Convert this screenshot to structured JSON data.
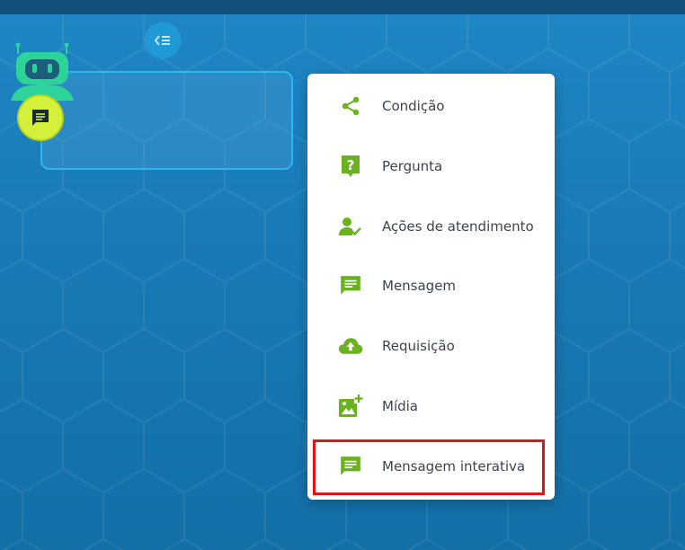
{
  "app": {
    "collapse_icon": "collapse-list-icon",
    "avatar_icon": "robot-icon",
    "node_badge_icon": "message-icon"
  },
  "colors": {
    "accent_green": "#6ab21e",
    "badge_yellow": "#d4f03a",
    "highlight_red": "#e01515",
    "robot_green": "#2ed39a"
  },
  "menu": {
    "items": [
      {
        "label": "Condição",
        "icon": "share-icon"
      },
      {
        "label": "Pergunta",
        "icon": "question-icon"
      },
      {
        "label": "Ações de atendimento",
        "icon": "person-check-icon"
      },
      {
        "label": "Mensagem",
        "icon": "message-icon"
      },
      {
        "label": "Requisição",
        "icon": "cloud-upload-icon"
      },
      {
        "label": "Mídia",
        "icon": "add-image-icon"
      },
      {
        "label": "Mensagem interativa",
        "icon": "message-icon"
      }
    ]
  }
}
